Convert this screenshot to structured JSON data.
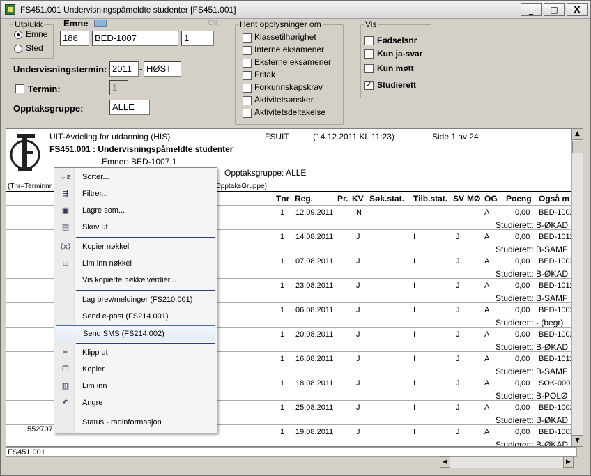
{
  "window": {
    "title": "FS451.001 Undervisningspåmeldte studenter [FS451.001]",
    "minimize": "_",
    "maximize": "□",
    "close": "X"
  },
  "utplukk": {
    "legend": "Utplukk",
    "options": [
      "Emne",
      "Sted"
    ],
    "selected": "Emne"
  },
  "emne": {
    "legend": "Emne",
    "ok_label": "OK",
    "inst": "186",
    "code": "BED-1007",
    "version": "1"
  },
  "hent": {
    "legend": "Hent opplysninger om",
    "items": [
      {
        "label": "Klassetilhørighet",
        "checked": false
      },
      {
        "label": "Interne eksamener",
        "checked": false
      },
      {
        "label": "Eksterne eksamener",
        "checked": false
      },
      {
        "label": "Fritak",
        "checked": false
      },
      {
        "label": "Forkunnskapskrav",
        "checked": false
      },
      {
        "label": "Aktivitetsønsker",
        "checked": false
      },
      {
        "label": "Aktivitetsdeltakelse",
        "checked": false
      }
    ]
  },
  "vis": {
    "legend": "Vis",
    "items": [
      {
        "label": "Fødselsnr",
        "checked": false
      },
      {
        "label": "Kun ja-svar",
        "checked": false
      },
      {
        "label": "Kun møtt",
        "checked": false
      },
      {
        "label": "Studierett",
        "checked": true
      }
    ]
  },
  "form": {
    "undervisningstermin_label": "Undervisningstermin:",
    "year": "2011",
    "dash": "-",
    "semester": "HØST",
    "termin_label": "Termin:",
    "termin_value": "1",
    "opptak_label": "Opptaksgruppe:",
    "opptak_value": "ALLE"
  },
  "report": {
    "org": "UIT-Avdeling for utdanning (HIS)",
    "system": "FSUIT",
    "timestamp": "(14.12.2011 Kl. 11:23)",
    "page": "Side 1 av 24",
    "title": "FS451.001 : Undervisningspåmeldte studenter",
    "emner": "Emner: BED-1007 1",
    "opptak": "Opptaksgruppe:  ALLE",
    "legend_left": "(Tnr=Terminnr",
    "legend_right": "OpptaksGruppe)",
    "columns": [
      "Tnr",
      "Reg.",
      "Pr.",
      "KV",
      "Søk.stat.",
      "Tilb.stat.",
      "SV",
      "MØ",
      "OG",
      "Poeng",
      "Også m"
    ],
    "rows": [
      {
        "tnr": "1",
        "reg": "12.09.2011",
        "kv": "N",
        "tilb": "",
        "sv": "",
        "og": "A",
        "poeng": "0,00",
        "ogsa": "BED-1002",
        "studierett": "Studierett: B-ØKAD"
      },
      {
        "tnr": "1",
        "reg": "14.08.2011",
        "kv": "J",
        "tilb": "I",
        "sv": "J",
        "og": "A",
        "poeng": "0,00",
        "ogsa": "BED-1011",
        "studierett": "Studierett: B-SAMF"
      },
      {
        "tnr": "1",
        "reg": "07.08.2011",
        "kv": "J",
        "tilb": "I",
        "sv": "J",
        "og": "A",
        "poeng": "0,00",
        "ogsa": "BED-1002",
        "studierett": "Studierett: B-ØKAD"
      },
      {
        "tnr": "1",
        "reg": "23.08.2011",
        "kv": "J",
        "tilb": "I",
        "sv": "J",
        "og": "A",
        "poeng": "0,00",
        "ogsa": "BED-1011",
        "studierett": "Studierett: B-SAMF"
      },
      {
        "tnr": "1",
        "reg": "06.08.2011",
        "kv": "J",
        "tilb": "I",
        "sv": "J",
        "og": "A",
        "poeng": "0,00",
        "ogsa": "BED-1002",
        "studierett": "Studierett: - (begr)"
      },
      {
        "tnr": "1",
        "reg": "20.08.2011",
        "kv": "J",
        "tilb": "I",
        "sv": "J",
        "og": "A",
        "poeng": "0,00",
        "ogsa": "BED-1002",
        "studierett": "Studierett: B-ØKAD"
      },
      {
        "tnr": "1",
        "reg": "16.08.2011",
        "kv": "J",
        "tilb": "I",
        "sv": "J",
        "og": "A",
        "poeng": "0,00",
        "ogsa": "BED-1011",
        "studierett": "Studierett: B-SAMF"
      },
      {
        "tnr": "1",
        "reg": "18.08.2011",
        "kv": "J",
        "tilb": "I",
        "sv": "J",
        "og": "A",
        "poeng": "0,00",
        "ogsa": "SOK-0001",
        "studierett": "Studierett: B-POLØ"
      },
      {
        "tnr": "1",
        "reg": "25.08.2011",
        "kv": "J",
        "tilb": "I",
        "sv": "J",
        "og": "A",
        "poeng": "0,00",
        "ogsa": "BED-1002",
        "studierett": "Studierett: B-ØKAD"
      },
      {
        "tnr": "1",
        "reg": "19.08.2011",
        "kv": "J",
        "tilb": "I",
        "sv": "J",
        "og": "A",
        "poeng": "0,00",
        "ogsa": "BED-1002",
        "studierett": "Studierett: B-ØKAD"
      }
    ],
    "partial_name": "552707  Andersen, Joakim"
  },
  "status_bar": "FS451.001",
  "context_menu": {
    "items": [
      {
        "label": "Sorter...",
        "icon": "sort-icon"
      },
      {
        "label": "Filtrer...",
        "icon": "filter-icon"
      },
      {
        "label": "Lagre som...",
        "icon": "save-icon"
      },
      {
        "label": "Skriv ut",
        "icon": "print-icon"
      },
      {
        "label": "Kopier nøkkel",
        "icon": "copy-key-icon"
      },
      {
        "label": "Lim inn nøkkel",
        "icon": "paste-key-icon"
      },
      {
        "label": "Vis kopierte nøkkelverdier...",
        "icon": ""
      },
      {
        "label": "Lag brev/meldinger (FS210.001)",
        "icon": ""
      },
      {
        "label": "Send e-post (FS214.001)",
        "icon": ""
      },
      {
        "label": "Send SMS (FS214.002)",
        "icon": ""
      },
      {
        "label": "Klipp ut",
        "icon": "cut-icon"
      },
      {
        "label": "Kopier",
        "icon": "copy-icon"
      },
      {
        "label": "Lim inn",
        "icon": "paste-icon"
      },
      {
        "label": "Angre",
        "icon": "undo-icon"
      },
      {
        "label": "Status - radinformasjon",
        "icon": ""
      }
    ],
    "highlighted": "Send SMS (FS214.002)"
  }
}
